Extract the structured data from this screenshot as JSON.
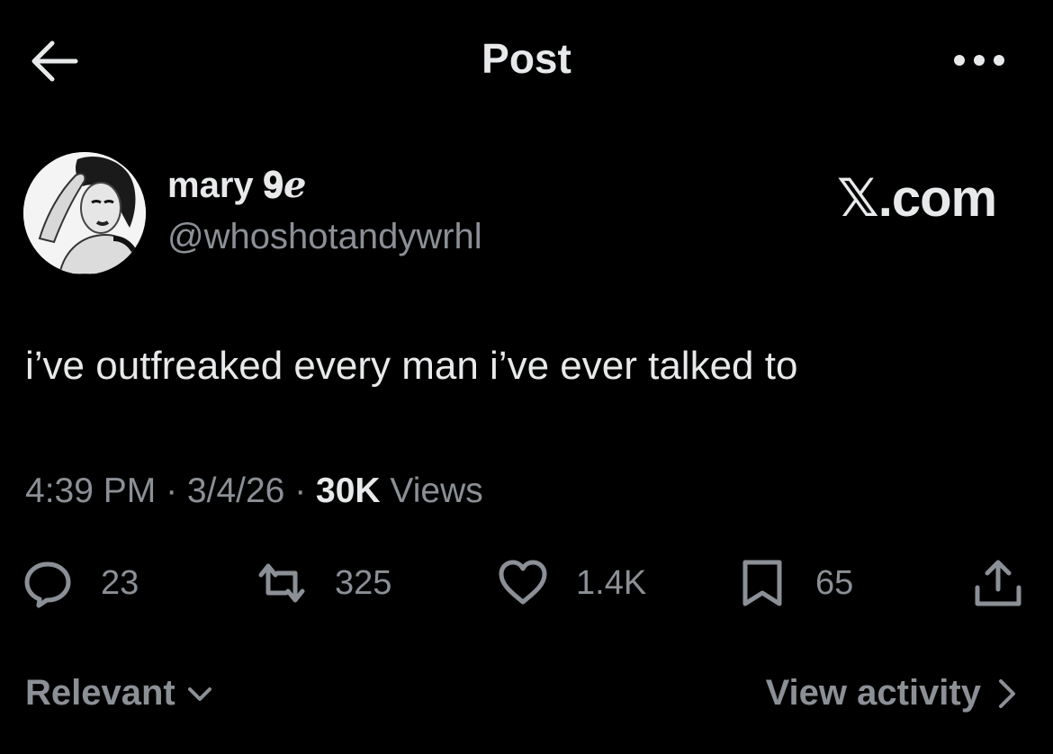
{
  "header": {
    "title": "Post",
    "back_icon": "arrow-left-icon",
    "more_icon": "more-horizontal-icon"
  },
  "author": {
    "display_name": "mary 𝟗ℯ",
    "handle": "@whoshotandywrhl",
    "avatar": "vintage-portrait-photo",
    "watermark": "𝕏.com"
  },
  "post": {
    "text": "i’ve outfreaked every man i’ve ever talked to",
    "time": "4:39 PM",
    "separator": " · ",
    "date": "3/4/26",
    "views_count": "30K",
    "views_label": " Views"
  },
  "actions": {
    "replies": "23",
    "reposts": "325",
    "likes": "1.4K",
    "bookmarks": "65"
  },
  "footer": {
    "sort_label": "Relevant",
    "view_activity_label": "View activity"
  },
  "colors": {
    "background": "#000000",
    "primary_text": "#e7e9ea",
    "secondary_text": "#8b9096"
  }
}
